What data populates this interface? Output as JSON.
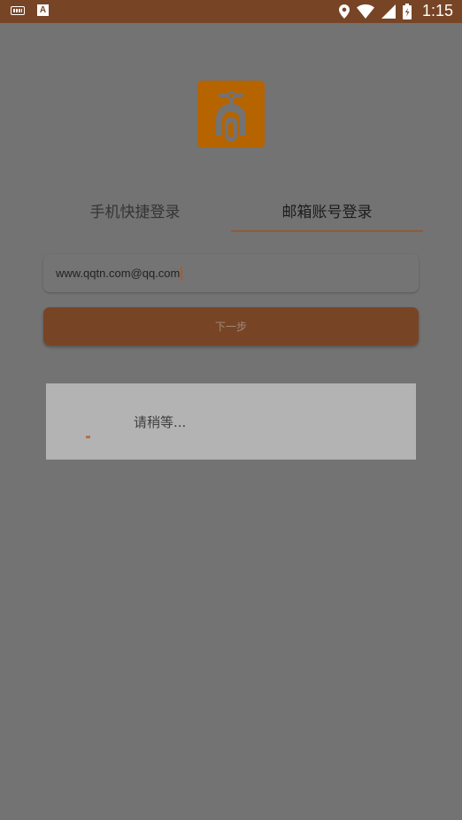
{
  "status_bar": {
    "time": "1:15",
    "left_icons": [
      "keyboard-icon",
      "a-notification-icon"
    ],
    "right_icons": [
      "location-icon",
      "wifi-icon",
      "signal-icon",
      "battery-icon"
    ],
    "background": "#774526"
  },
  "app": {
    "logo_icon": "scooter-icon",
    "logo_color": "#b56400"
  },
  "tabs": [
    {
      "label": "手机快捷登录",
      "selected": false
    },
    {
      "label": "邮箱账号登录",
      "selected": true
    }
  ],
  "email_input": {
    "value": "www.qqtn.com@qq.com"
  },
  "next_button": {
    "label": "下一步",
    "color": "#774526"
  },
  "loading_dialog": {
    "message": "请稍等..."
  }
}
